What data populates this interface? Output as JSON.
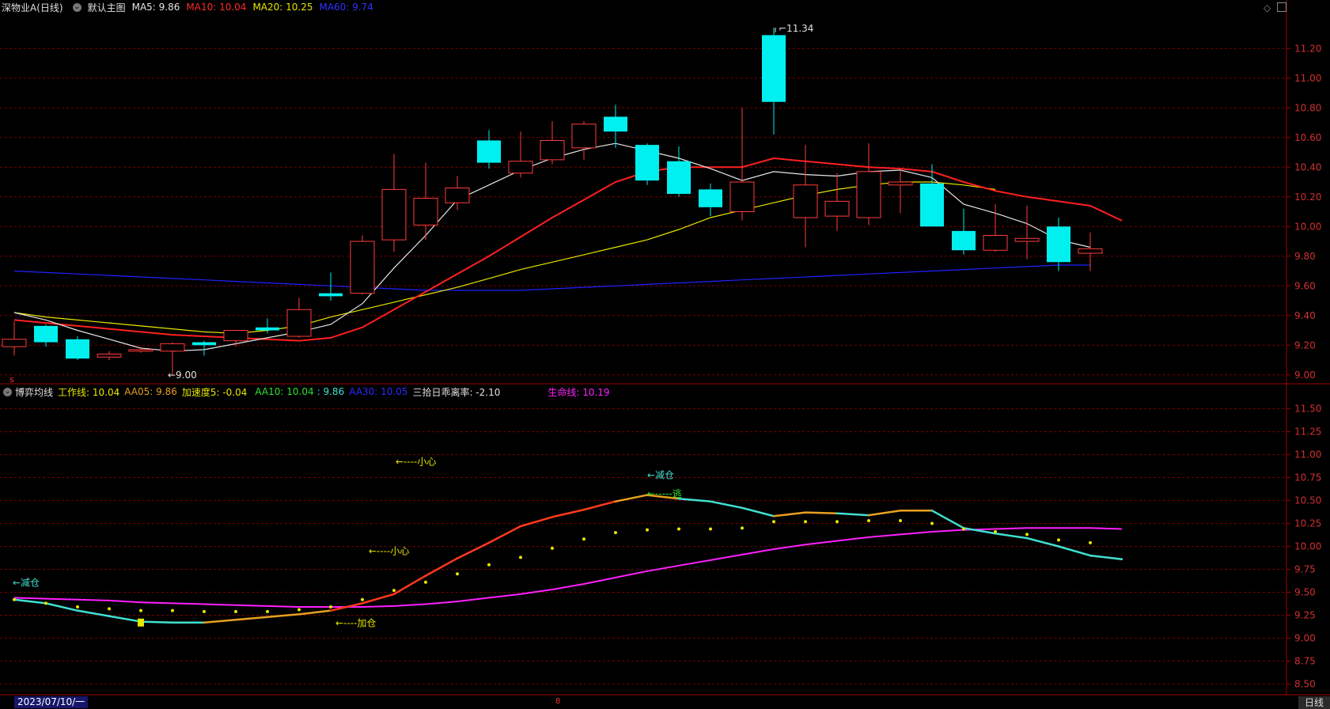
{
  "header": {
    "stock_name": "深物业A",
    "period_label": "(日线)",
    "template_label": "默认主图",
    "ma5": "MA5: 9.86",
    "ma10": "MA10: 10.04",
    "ma20": "MA20: 10.25",
    "ma60": "MA60: 9.74"
  },
  "indicator_header": {
    "name": "博弈均线",
    "work_line": "工作线: 10.04",
    "aa05": "AA05: 9.86",
    "accel": "加速度5: -0.04",
    "aa10": "AA10: 10.04",
    "aa10b": ": 9.86",
    "aa30": "AA30: 10.05",
    "deviation": "三拾日乖离率: -2.10",
    "life_line": "生命线: 10.19"
  },
  "price_axis": [
    "11.20",
    "11.00",
    "10.80",
    "10.60",
    "10.40",
    "10.20",
    "10.00",
    "9.80",
    "9.60",
    "9.40",
    "9.20",
    "9.00"
  ],
  "indicator_axis": [
    "11.50",
    "11.25",
    "11.00",
    "10.75",
    "10.50",
    "10.25",
    "10.00",
    "9.75",
    "9.50",
    "9.25",
    "9.00",
    "8.75",
    "8.50"
  ],
  "annotations": {
    "high": "11.34",
    "low": "←9.00",
    "reduce1": "←减仓",
    "reduce2": "←减仓",
    "careful1": "←----小心",
    "careful2": "←----小心",
    "add": "←----加仓",
    "escape": "←-----逃",
    "s_marker": "s"
  },
  "bottom": {
    "date": "2023/07/10/一",
    "period": "日线",
    "tick": "8"
  },
  "colors": {
    "up": "#ff3b3b",
    "down": "#00f0f0",
    "ma5": "#e6e6e6",
    "ma10": "#ff2020",
    "ma20": "#e6e600",
    "ma60": "#2020ff",
    "life": "#ff20ff",
    "work_orange": "#e8a020",
    "work_cyan": "#40e0d0",
    "work_red": "#ff3a1a",
    "grid": "#7a0000"
  },
  "chart_data": {
    "type": "candlestick",
    "ylim": [
      8.94,
      11.42
    ],
    "candles": [
      {
        "o": 9.19,
        "h": 9.36,
        "l": 9.13,
        "c": 9.24
      },
      {
        "o": 9.33,
        "h": 9.34,
        "l": 9.19,
        "c": 9.22
      },
      {
        "o": 9.24,
        "h": 9.26,
        "l": 9.1,
        "c": 9.11
      },
      {
        "o": 9.12,
        "h": 9.16,
        "l": 9.1,
        "c": 9.14
      },
      {
        "o": 9.16,
        "h": 9.19,
        "l": 9.15,
        "c": 9.17
      },
      {
        "o": 9.16,
        "h": 9.22,
        "l": 9.0,
        "c": 9.21
      },
      {
        "o": 9.22,
        "h": 9.23,
        "l": 9.13,
        "c": 9.2
      },
      {
        "o": 9.23,
        "h": 9.3,
        "l": 9.19,
        "c": 9.3
      },
      {
        "o": 9.32,
        "h": 9.38,
        "l": 9.28,
        "c": 9.3
      },
      {
        "o": 9.26,
        "h": 9.52,
        "l": 9.25,
        "c": 9.44
      },
      {
        "o": 9.55,
        "h": 9.69,
        "l": 9.5,
        "c": 9.53
      },
      {
        "o": 9.55,
        "h": 9.94,
        "l": 9.54,
        "c": 9.9
      },
      {
        "o": 9.91,
        "h": 10.49,
        "l": 9.83,
        "c": 10.25
      },
      {
        "o": 10.01,
        "h": 10.43,
        "l": 9.91,
        "c": 10.19
      },
      {
        "o": 10.16,
        "h": 10.34,
        "l": 10.11,
        "c": 10.26
      },
      {
        "o": 10.58,
        "h": 10.65,
        "l": 10.39,
        "c": 10.43
      },
      {
        "o": 10.36,
        "h": 10.64,
        "l": 10.33,
        "c": 10.44
      },
      {
        "o": 10.45,
        "h": 10.71,
        "l": 10.42,
        "c": 10.58
      },
      {
        "o": 10.53,
        "h": 10.71,
        "l": 10.45,
        "c": 10.69
      },
      {
        "o": 10.74,
        "h": 10.82,
        "l": 10.53,
        "c": 10.64
      },
      {
        "o": 10.55,
        "h": 10.56,
        "l": 10.28,
        "c": 10.31
      },
      {
        "o": 10.44,
        "h": 10.54,
        "l": 10.2,
        "c": 10.22
      },
      {
        "o": 10.25,
        "h": 10.29,
        "l": 10.07,
        "c": 10.13
      },
      {
        "o": 10.1,
        "h": 10.8,
        "l": 10.04,
        "c": 10.3
      },
      {
        "o": 11.29,
        "h": 11.34,
        "l": 10.62,
        "c": 10.84
      },
      {
        "o": 10.06,
        "h": 10.55,
        "l": 9.86,
        "c": 10.28
      },
      {
        "o": 10.07,
        "h": 10.36,
        "l": 9.97,
        "c": 10.17
      },
      {
        "o": 10.06,
        "h": 10.56,
        "l": 10.01,
        "c": 10.37
      },
      {
        "o": 10.28,
        "h": 10.38,
        "l": 10.09,
        "c": 10.3
      },
      {
        "o": 10.29,
        "h": 10.42,
        "l": 10.0,
        "c": 10.0
      },
      {
        "o": 9.97,
        "h": 10.12,
        "l": 9.81,
        "c": 9.84
      },
      {
        "o": 9.84,
        "h": 10.15,
        "l": 9.83,
        "c": 9.94
      },
      {
        "o": 9.9,
        "h": 10.14,
        "l": 9.78,
        "c": 9.92
      },
      {
        "o": 10.0,
        "h": 10.06,
        "l": 9.7,
        "c": 9.76
      },
      {
        "o": 9.82,
        "h": 9.96,
        "l": 9.7,
        "c": 9.85
      }
    ],
    "ma5": [
      9.42,
      9.37,
      9.3,
      9.24,
      9.18,
      9.16,
      9.17,
      9.21,
      9.25,
      9.29,
      9.34,
      9.48,
      9.72,
      9.94,
      10.18,
      10.28,
      10.38,
      10.46,
      10.52,
      10.56,
      10.51,
      10.46,
      10.39,
      10.31,
      10.37,
      10.35,
      10.34,
      10.37,
      10.38,
      10.33,
      10.15,
      10.09,
      10.02,
      9.91,
      9.86
    ],
    "ma10": [
      9.37,
      9.35,
      9.33,
      9.31,
      9.29,
      9.27,
      9.26,
      9.25,
      9.24,
      9.23,
      9.25,
      9.32,
      9.44,
      9.56,
      9.68,
      9.8,
      9.93,
      10.06,
      10.18,
      10.3,
      10.37,
      10.4,
      10.4,
      10.4,
      10.46,
      10.44,
      10.42,
      10.4,
      10.39,
      10.37,
      10.3,
      10.24,
      10.2,
      10.17,
      10.14,
      10.04
    ],
    "ma20": [
      9.42,
      9.39,
      9.37,
      9.35,
      9.33,
      9.31,
      9.29,
      9.28,
      9.3,
      9.33,
      9.39,
      9.44,
      9.49,
      9.54,
      9.59,
      9.65,
      9.71,
      9.76,
      9.81,
      9.86,
      9.91,
      9.98,
      10.06,
      10.11,
      10.16,
      10.21,
      10.25,
      10.28,
      10.3,
      10.3,
      10.28,
      10.25
    ],
    "ma60": [
      9.7,
      9.69,
      9.68,
      9.67,
      9.66,
      9.65,
      9.64,
      9.63,
      9.62,
      9.61,
      9.6,
      9.59,
      9.58,
      9.57,
      9.57,
      9.57,
      9.57,
      9.58,
      9.59,
      9.6,
      9.61,
      9.62,
      9.63,
      9.64,
      9.65,
      9.66,
      9.67,
      9.68,
      9.69,
      9.7,
      9.71,
      9.72,
      9.73,
      9.74,
      9.74
    ],
    "indicator": {
      "ylim": [
        8.4,
        11.6
      ],
      "work_line": [
        9.42,
        9.38,
        9.3,
        9.24,
        9.18,
        9.17,
        9.17,
        9.2,
        9.23,
        9.26,
        9.3,
        9.38,
        9.48,
        9.68,
        9.87,
        10.04,
        10.22,
        10.32,
        10.4,
        10.49,
        10.56,
        10.52,
        10.49,
        10.42,
        10.33,
        10.37,
        10.36,
        10.34,
        10.39,
        10.39,
        10.2,
        10.14,
        10.09,
        10.0,
        9.9,
        9.86
      ],
      "work_colors": [
        "c",
        "c",
        "c",
        "c",
        "c",
        "c",
        "o",
        "o",
        "o",
        "o",
        "r",
        "r",
        "r",
        "r",
        "r",
        "r",
        "r",
        "r",
        "r",
        "o",
        "o",
        "c",
        "c",
        "c",
        "o",
        "o",
        "c",
        "o",
        "o",
        "c",
        "c",
        "c",
        "c",
        "c",
        "c"
      ],
      "life_line": [
        9.44,
        9.43,
        9.42,
        9.41,
        9.39,
        9.38,
        9.37,
        9.36,
        9.35,
        9.34,
        9.34,
        9.34,
        9.35,
        9.37,
        9.4,
        9.44,
        9.48,
        9.53,
        9.59,
        9.66,
        9.73,
        9.79,
        9.85,
        9.91,
        9.97,
        10.02,
        10.06,
        10.1,
        10.13,
        10.16,
        10.18,
        10.19,
        10.2,
        10.2,
        10.2,
        10.19
      ],
      "dots": [
        9.42,
        9.38,
        9.34,
        9.32,
        9.3,
        9.3,
        9.29,
        9.29,
        9.29,
        9.31,
        9.34,
        9.42,
        9.52,
        9.61,
        9.7,
        9.8,
        9.88,
        9.98,
        10.08,
        10.15,
        10.18,
        10.19,
        10.19,
        10.2,
        10.27,
        10.27,
        10.27,
        10.28,
        10.28,
        10.25,
        10.19,
        10.16,
        10.13,
        10.07,
        10.04
      ]
    }
  }
}
